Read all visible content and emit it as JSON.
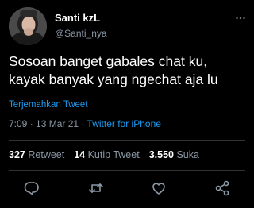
{
  "author": {
    "display_name": "Santi kzL",
    "handle": "@Santi_nya"
  },
  "tweet": {
    "line1": "Sosoan banget gabales chat ku,",
    "line2": "kayak banyak yang ngechat aja lu",
    "translate_label": "Terjemahkan Tweet",
    "time": "7:09",
    "date": "13 Mar 21",
    "separator": "·",
    "source": "Twitter for iPhone"
  },
  "stats": {
    "retweets": "327",
    "retweets_label": "Retweet",
    "quotes": "14",
    "quotes_label": "Kutip Tweet",
    "likes": "3.550",
    "likes_label": "Suka"
  },
  "icons": [
    "more-icon",
    "reply-icon",
    "retweet-icon",
    "like-icon",
    "share-icon"
  ],
  "colors": {
    "background": "#000000",
    "accent": "#1d9bf0",
    "secondary_text": "#8b98a5"
  }
}
